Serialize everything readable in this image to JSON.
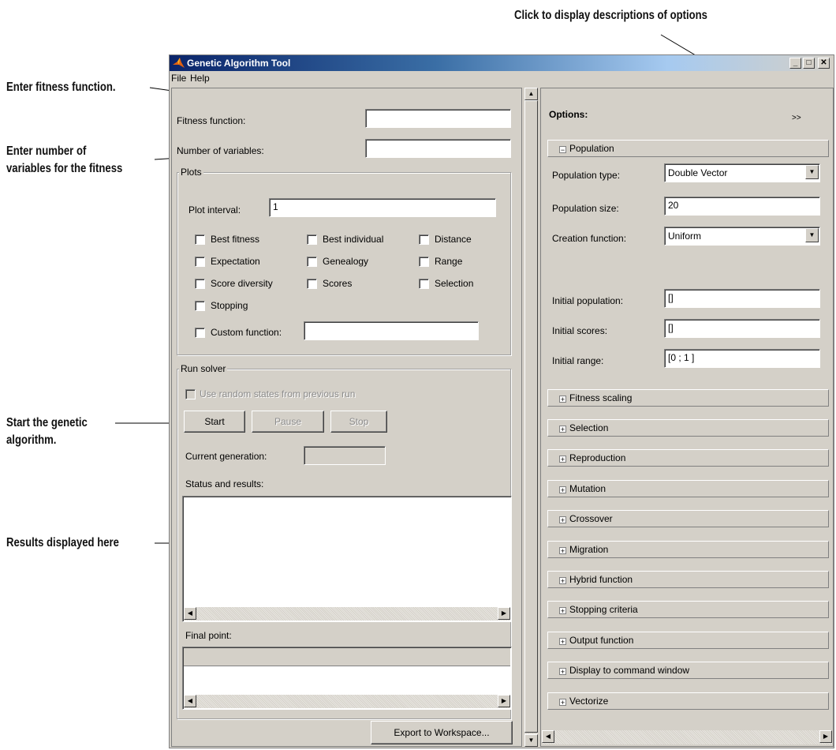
{
  "annotations": {
    "top": "Click to display descriptions of options",
    "fitness": "Enter fitness function.",
    "numvars_line1": "Enter number of",
    "numvars_line2": "variables for the fitness",
    "start_line1": "Start the genetic",
    "start_line2": "algorithm.",
    "results": "Results displayed here"
  },
  "window": {
    "title": "Genetic Algorithm Tool",
    "controls": [
      "_",
      "□",
      "✕"
    ]
  },
  "menu": [
    "File",
    "Help"
  ],
  "left": {
    "fitness_label": "Fitness function:",
    "fitness_value": "",
    "numvars_label": "Number of variables:",
    "numvars_value": "",
    "plots": {
      "title": "Plots",
      "interval_label": "Plot interval:",
      "interval_value": "1",
      "checkboxes": [
        "Best fitness",
        "Best individual",
        "Distance",
        "Expectation",
        "Genealogy",
        "Range",
        "Score diversity",
        "Scores",
        "Selection",
        "Stopping"
      ],
      "custom_label": "Custom function:",
      "custom_value": ""
    },
    "run": {
      "title": "Run solver",
      "random_states": "Use random states from previous run",
      "start": "Start",
      "pause": "Pause",
      "stop": "Stop",
      "generation_label": "Current generation:",
      "status_label": "Status and results:",
      "final_label": "Final point:"
    },
    "export": "Export to Workspace..."
  },
  "right": {
    "options_label": "Options:",
    "toggle": ">>",
    "population": {
      "header": "Population",
      "type_label": "Population type:",
      "type_value": "Double Vector",
      "size_label": "Population size:",
      "size_value": "20",
      "creation_label": "Creation function:",
      "creation_value": "Uniform",
      "initpop_label": "Initial population:",
      "initpop_value": "[]",
      "initscores_label": "Initial scores:",
      "initscores_value": "[]",
      "initrange_label": "Initial range:",
      "initrange_value": "[0 ; 1 ]"
    },
    "sections": [
      "Fitness scaling",
      "Selection",
      "Reproduction",
      "Mutation",
      "Crossover",
      "Migration",
      "Hybrid function",
      "Stopping criteria",
      "Output function",
      "Display to command window",
      "Vectorize"
    ]
  }
}
